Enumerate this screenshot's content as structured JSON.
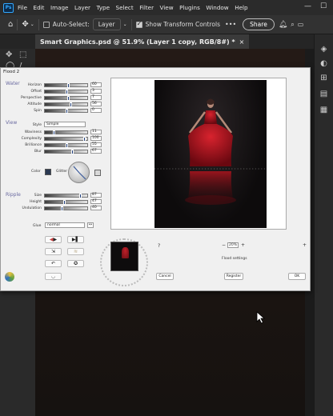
{
  "menubar": {
    "app_logo": "Ps",
    "items": [
      "File",
      "Edit",
      "Image",
      "Layer",
      "Type",
      "Select",
      "Filter",
      "View",
      "Plugins",
      "Window",
      "Help"
    ],
    "win_min": "—",
    "win_max": "☐"
  },
  "options": {
    "auto_select_label": "Auto-Select:",
    "auto_select_value": "Layer",
    "transform_label": "Show Transform Controls",
    "share_label": "Share"
  },
  "document": {
    "tab_title": "Smart Graphics.psd @ 51.9% (Layer 1 copy, RGB/8#) *",
    "tab_close": "×"
  },
  "dialog": {
    "title": "Flood 2",
    "water": {
      "label": "Water",
      "sliders": [
        {
          "name": "Horizon",
          "value": "60",
          "level": 0.55
        },
        {
          "name": "Offset",
          "value": "3",
          "level": 0.5
        },
        {
          "name": "Perspective",
          "value": "7",
          "level": 0.55
        },
        {
          "name": "Altitude",
          "value": "56",
          "level": 0.6
        },
        {
          "name": "Spin",
          "value": "0",
          "level": 0.5
        }
      ]
    },
    "view": {
      "label": "View",
      "style_label": "Style",
      "style_value": "Simple",
      "sliders": [
        {
          "name": "Waviness",
          "value": "11",
          "level": 0.2
        },
        {
          "name": "Complexity",
          "value": "100",
          "level": 0.95
        },
        {
          "name": "Brilliance",
          "value": "55",
          "level": 0.5
        },
        {
          "name": "Blur",
          "value": "67",
          "level": 0.65
        }
      ],
      "color_label": "Color",
      "glitter_label": "Glitter"
    },
    "ripple": {
      "label": "Ripple",
      "sliders": [
        {
          "name": "Size",
          "value": "87",
          "level": 0.85
        },
        {
          "name": "Height",
          "value": "47",
          "level": 0.45
        },
        {
          "name": "Undulation",
          "value": "40",
          "level": 0.4
        }
      ]
    },
    "glue_label": "Glue",
    "glue_value": "normal",
    "help_label": "?",
    "zoom_minus": "−",
    "zoom_value": "20%",
    "zoom_plus": "+",
    "flood_settings_label": "Flood settings",
    "cancel_label": "Cancel",
    "register_label": "Register",
    "ok_label": "OK"
  }
}
